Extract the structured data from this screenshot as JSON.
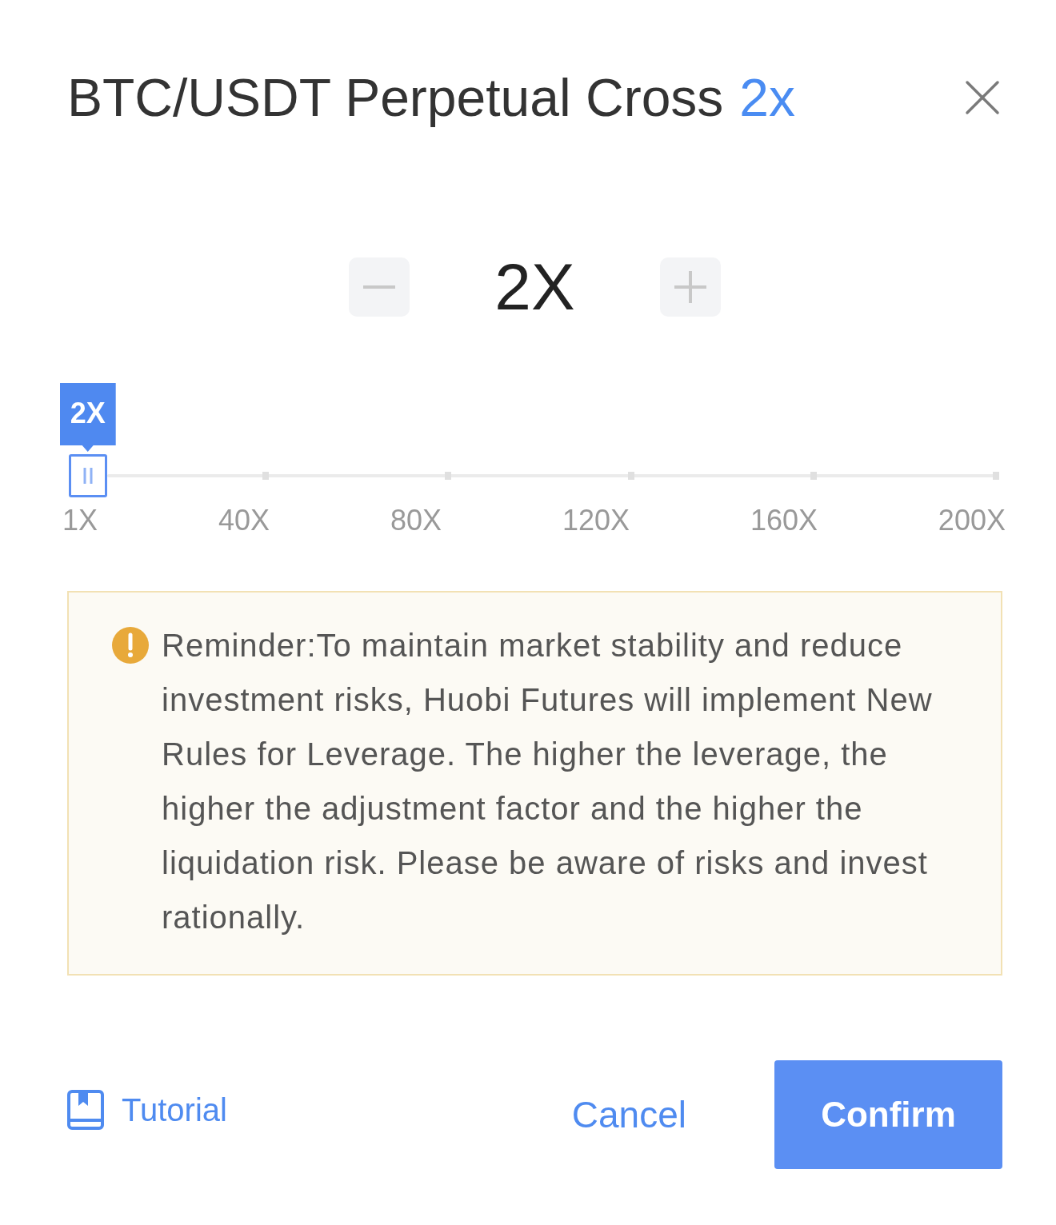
{
  "dialog": {
    "title": "BTC/USDT Perpetual Cross",
    "title_leverage": "2x"
  },
  "stepper": {
    "value": "2X"
  },
  "slider": {
    "tooltip": "2X",
    "level": 0.005,
    "marks": [
      "1X",
      "40X",
      "80X",
      "120X",
      "160X",
      "200X"
    ]
  },
  "notice": {
    "text": "Reminder:To maintain market stability and reduce investment risks, Huobi Futures will implement New Rules for Leverage. The higher the leverage, the higher the adjustment factor and the higher the liquidation risk. Please be aware of risks and invest rationally."
  },
  "footer": {
    "tutorial": "Tutorial",
    "buttons": [
      {
        "label": "Cancel",
        "kind": "text"
      },
      {
        "label": "Confirm",
        "kind": "primary"
      }
    ]
  }
}
